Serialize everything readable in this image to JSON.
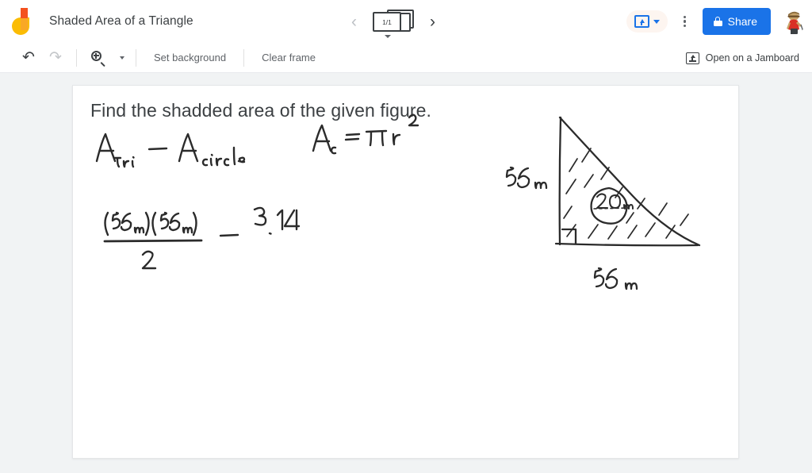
{
  "app": {
    "name": "Jamboard",
    "logo_icon": "jamboard-logo"
  },
  "header": {
    "title": "Shaded Area of a Triangle",
    "prev_frame_icon": "chevron-left-icon",
    "next_frame_icon": "chevron-right-icon",
    "frame_counter": "1/1",
    "frame_stack_icon": "frame-stack-icon",
    "present_icon": "present-icon",
    "present_caret_icon": "chevron-down-icon",
    "more_icon": "kebab-menu-icon",
    "share_label": "Share",
    "share_lock_icon": "lock-icon",
    "share_color": "#1a73e8",
    "avatar_icon": "user-avatar"
  },
  "toolbar": {
    "undo_icon": "undo-icon",
    "redo_icon": "redo-icon",
    "zoom_icon": "zoom-in-icon",
    "zoom_caret_icon": "chevron-down-icon",
    "set_background_label": "Set background",
    "clear_frame_label": "Clear frame",
    "open_jamboard_label": "Open on a Jamboard",
    "open_jamboard_icon": "open-on-jamboard-icon"
  },
  "tools": [
    {
      "name": "pen-tool",
      "icon": "pen-icon",
      "active": true
    },
    {
      "name": "eraser-tool",
      "icon": "eraser-icon",
      "active": false
    },
    {
      "name": "select-tool",
      "icon": "cursor-arrow-icon",
      "active": false
    },
    {
      "name": "sticky-note-tool",
      "icon": "sticky-note-icon",
      "active": false
    },
    {
      "name": "image-tool",
      "icon": "image-icon",
      "active": false
    },
    {
      "name": "shape-tool",
      "icon": "circle-shape-icon",
      "active": false
    },
    {
      "name": "text-box-tool",
      "icon": "text-box-icon",
      "active": false
    },
    {
      "name": "laser-pointer-tool",
      "icon": "laser-pointer-icon",
      "active": false
    }
  ],
  "canvas": {
    "prompt": "Find the shadded area of the given figure.",
    "handwriting": {
      "line1_left": "A",
      "line1_left_sub": "tri",
      "line1_minus": "–",
      "line1_right": "A",
      "line1_right_sub": "circle",
      "formula_right": "A",
      "formula_right_sub": "c",
      "formula_right_rest": "= πr",
      "formula_right_exp": "2",
      "fraction_numerator": "(56ₘ)(56ₘ)",
      "fraction_denominator": "2",
      "fraction_minus": "–",
      "pi_value": "3.14"
    },
    "figure": {
      "shape": "right-triangle-with-inscribed-circle",
      "vertical_side_label": "56 m",
      "horizontal_side_label": "56 m",
      "circle_label": "20 m",
      "right_angle_marker": true,
      "shading": "diagonal-hatch"
    }
  }
}
